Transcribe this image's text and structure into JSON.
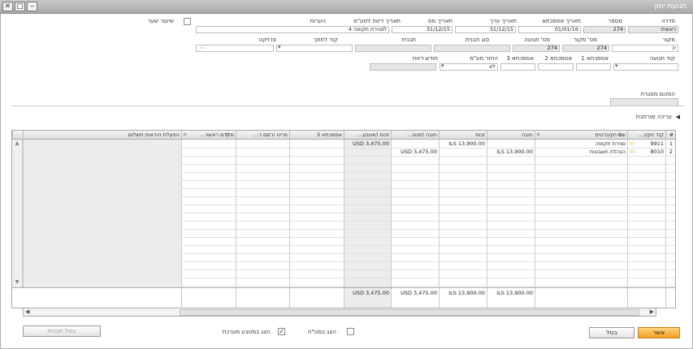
{
  "window": {
    "title": "תנועת יומן"
  },
  "header": {
    "series": {
      "label": "סדרה",
      "value": "ראשית"
    },
    "number": {
      "label": "מספר",
      "value": "274"
    },
    "posting_date": {
      "label": "תאריך אסמכתא",
      "value": "01/01/16"
    },
    "value_date": {
      "label": "תאריך ערך",
      "value": "31/12/15"
    },
    "tax_date": {
      "label": "תאריך מס",
      "value": "31/12/15"
    },
    "vat_report_date": {
      "label": "תאריך דיווח למע\"מ",
      "value": ""
    },
    "remarks": {
      "label": "הערות",
      "value": "לסגירת תקופה 4"
    },
    "rate_diff": {
      "label": "שיעור שער",
      "checked": false
    },
    "origin": {
      "label": "מקור",
      "value": "יכ"
    },
    "origin_no": {
      "label": "מס' מקור",
      "value": "274"
    },
    "trans_no": {
      "label": "מס' תנועה",
      "value": "274"
    },
    "template_type": {
      "label": "סוג תבנית",
      "value": ""
    },
    "template": {
      "label": "תבנית",
      "value": ""
    },
    "indicator": {
      "label": "קוד לחתך",
      "value": ""
    },
    "project": {
      "label": "פרויקט",
      "value": ""
    },
    "trans_code": {
      "label": "קוד תנועה",
      "value": ""
    },
    "ref1": {
      "label": "אסמכתא 1",
      "value": ""
    },
    "ref2": {
      "label": "אסמכתא 2",
      "value": ""
    },
    "ref3": {
      "label": "אסמכתא 3",
      "value": ""
    },
    "vat_return": {
      "label": "החזר מע\"מ",
      "value": "לא"
    },
    "report_month": {
      "label": "חודש דיווח",
      "value": ""
    },
    "total": {
      "label": "הסכום מסגרת",
      "value": ""
    }
  },
  "expander": {
    "label": "עריכה מורחבת",
    "arrow": "◀"
  },
  "grid": {
    "headers": {
      "rownum": "#",
      "account": "קוד חין/כ...",
      "name": "שם חין/כרטיס",
      "debit": "חובה",
      "credit": "זכות",
      "debit_fc": "חובה (מטב...",
      "credit_fc": "זכות (מטבע...",
      "ref3": "אסמכתא 3",
      "cashflow": "פריט זרםם ר...",
      "tax_group": "מקדם ראשוי...",
      "pay_instr": "הפעלת הוראות תשלום"
    },
    "rows": [
      {
        "rownum": "1",
        "account": "9911",
        "name": "סגירת תקופה",
        "debit": "",
        "credit": "ILS 13,900.00",
        "debit_fc": "",
        "credit_fc": "USD 3,475.00"
      },
      {
        "rownum": "2",
        "account": "8010",
        "name": "הנהלת חשבונות",
        "debit": "ILS 13,900.00",
        "credit": "",
        "debit_fc": "USD 3,475.00",
        "credit_fc": ""
      }
    ],
    "totals": {
      "debit": "ILS 13,900.00",
      "credit": "ILS 13,900.00",
      "debit_fc": "USD 3,475.00",
      "credit_fc": "USD 3,475.00"
    }
  },
  "footer": {
    "ok": "אשר",
    "cancel": "בטל",
    "show_fc": {
      "label": "הצג במט\"ח",
      "checked": false
    },
    "show_sys": {
      "label": "הצג במטבע מערכת",
      "checked": true
    },
    "cancel_template": "בטל תבנית"
  },
  "colors": {
    "ok_button": "#f2a020",
    "titlebar": "#a9a9a9",
    "arrow": "#e0a000"
  }
}
